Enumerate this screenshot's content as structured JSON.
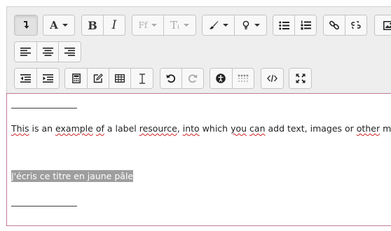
{
  "toolbar": {
    "font_color_glyph": "A",
    "bold_glyph": "B",
    "italic_glyph": "I",
    "font_family_glyph": "Ff",
    "font_size_glyph": "Tᵢ"
  },
  "editor": {
    "separator_top": "_______________",
    "paragraph_parts": [
      {
        "text": "This",
        "spell": true
      },
      {
        "text": " is an ",
        "spell": false
      },
      {
        "text": "example",
        "spell": true
      },
      {
        "text": " ",
        "spell": false
      },
      {
        "text": "of",
        "spell": true
      },
      {
        "text": " a label ",
        "spell": false
      },
      {
        "text": "resource",
        "spell": true
      },
      {
        "text": ", ",
        "spell": false
      },
      {
        "text": "into",
        "spell": true
      },
      {
        "text": " which ",
        "spell": false
      },
      {
        "text": "you",
        "spell": true
      },
      {
        "text": " ",
        "spell": false
      },
      {
        "text": "can",
        "spell": true
      },
      {
        "text": " add text, images or ",
        "spell": false
      },
      {
        "text": "other",
        "spell": true
      },
      {
        "text": " media",
        "spell": false
      }
    ],
    "highlighted_line": "J'écris ce titre en jaune pâle",
    "separator_bottom": "_______________"
  },
  "colors": {
    "toolbar_bg": "#eeeeee",
    "highlight_bg": "#9e9e9e",
    "editor_border": "#c07a9a",
    "spell_underline": "#d02020"
  }
}
